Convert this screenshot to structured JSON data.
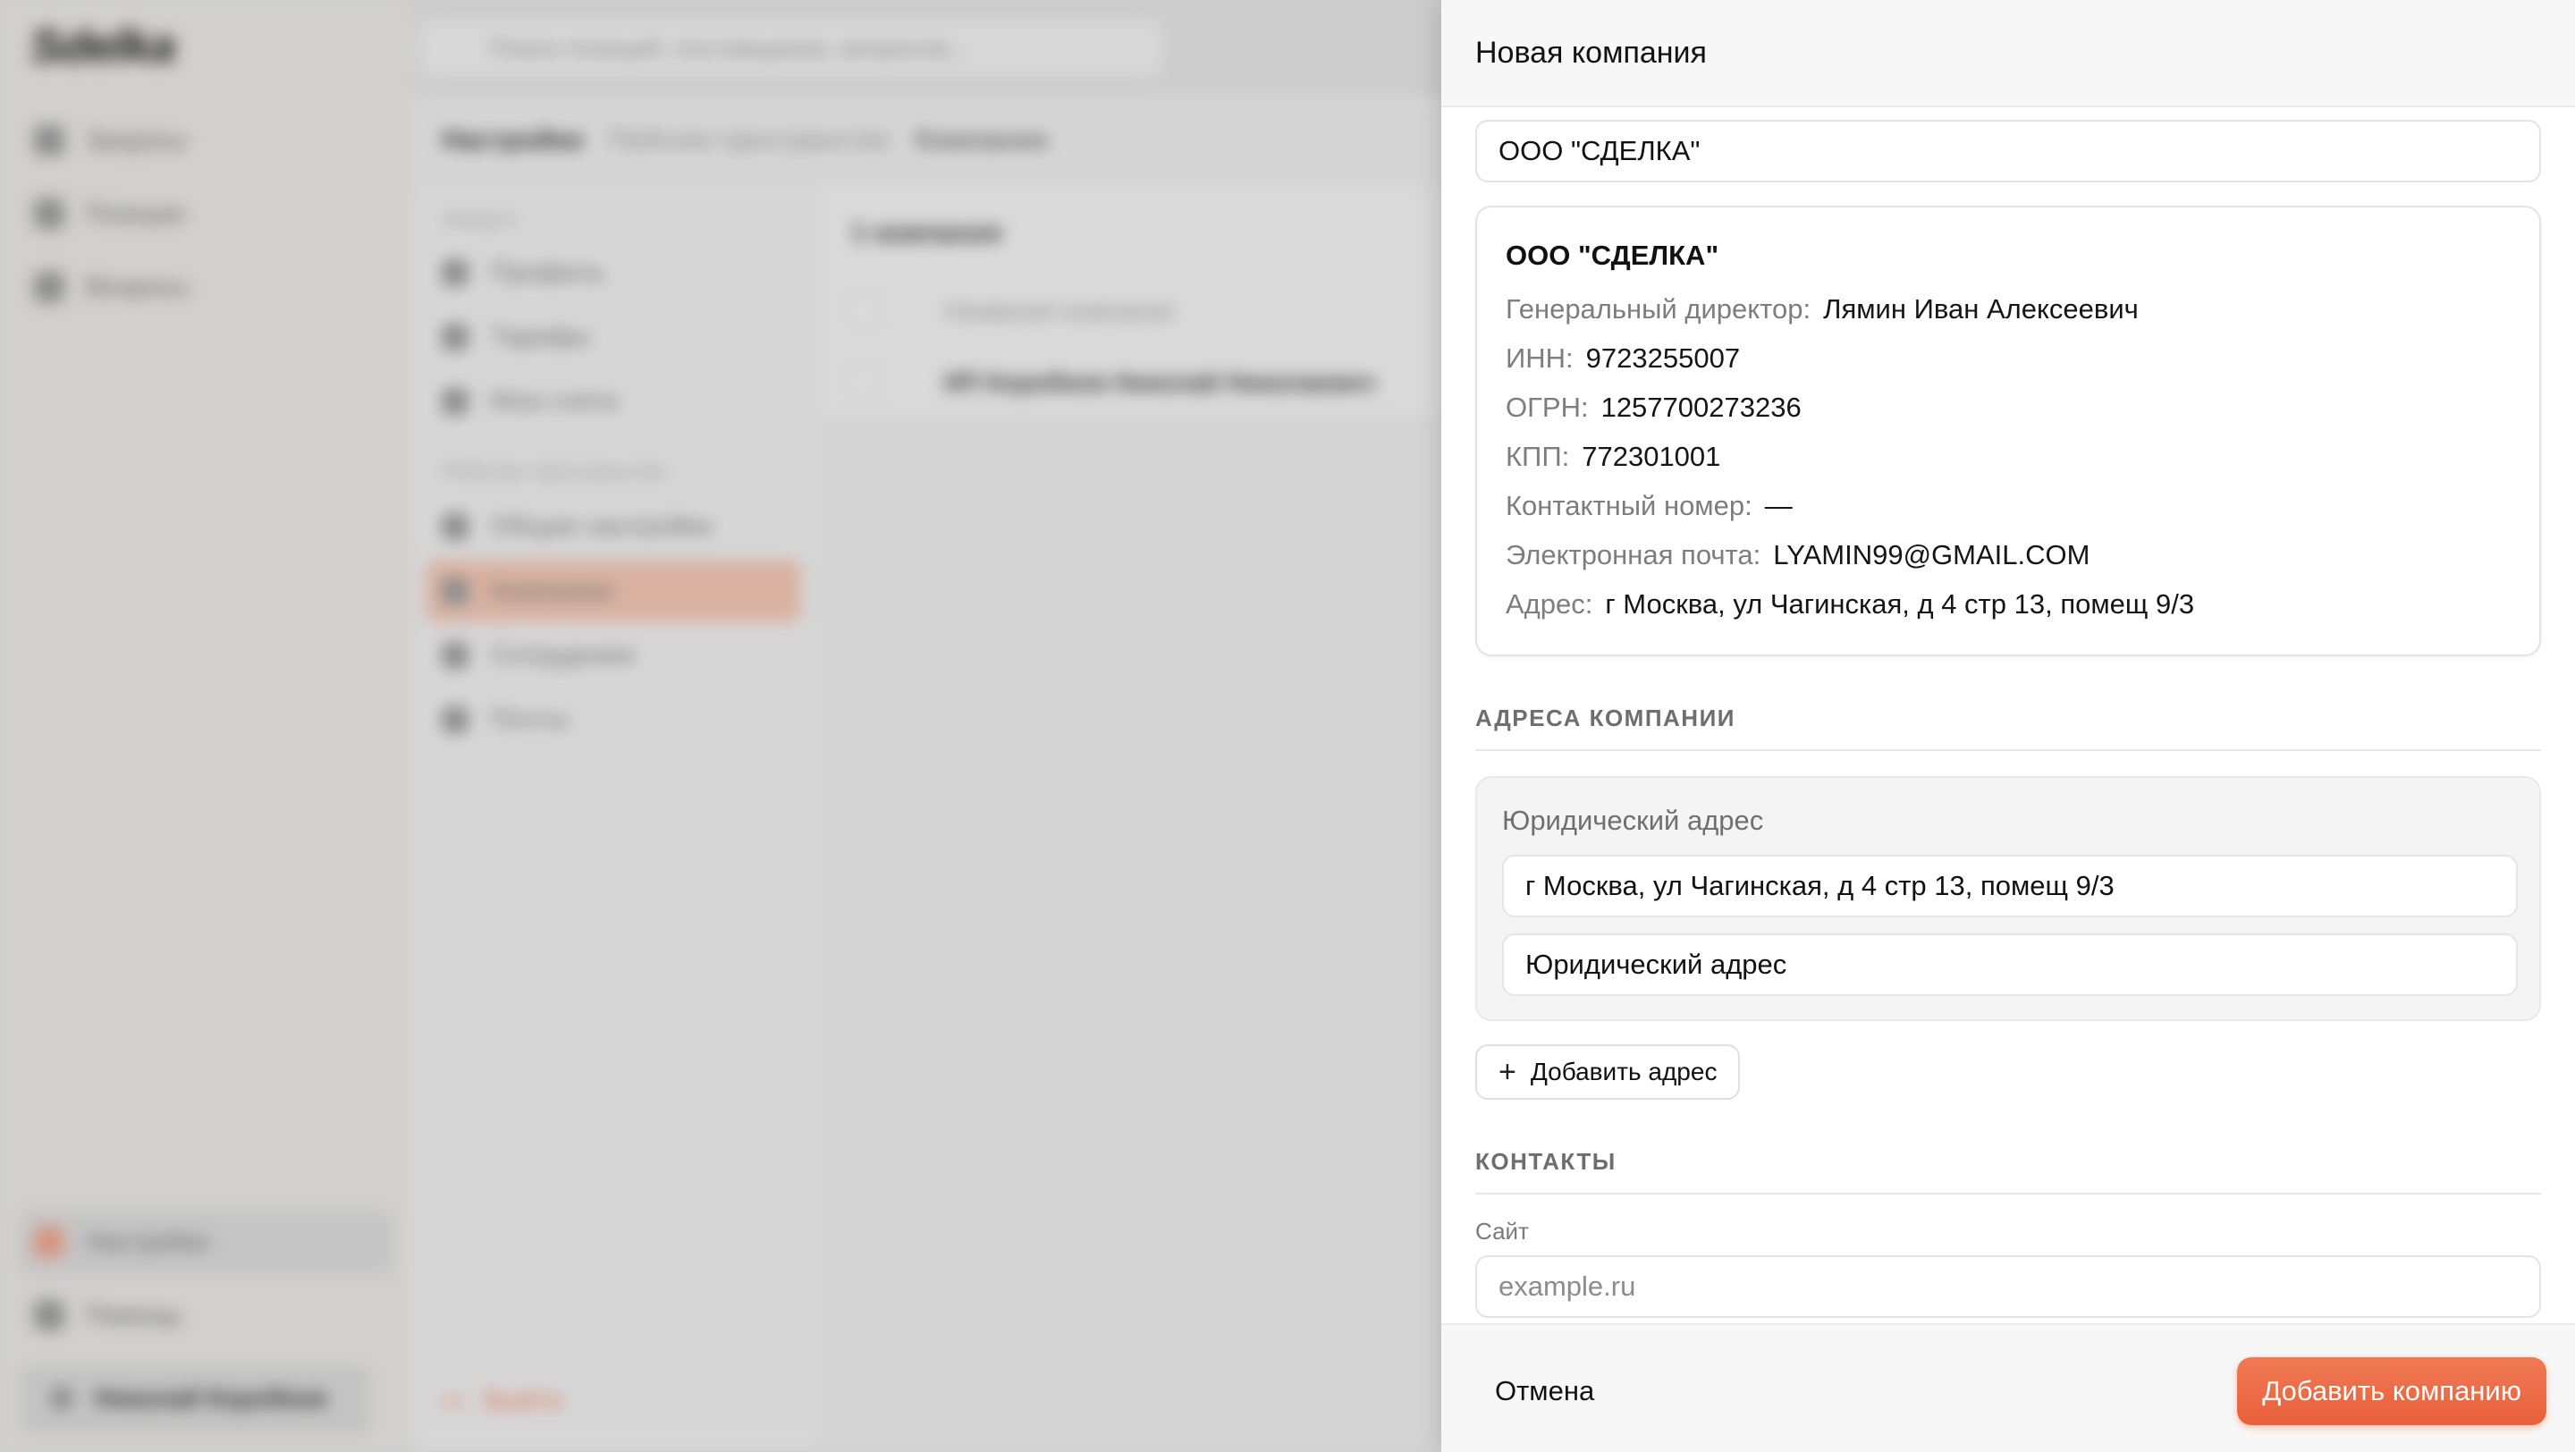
{
  "background": {
    "logo": "Sdelka",
    "search_placeholder": "Поиск позиций, поставщиков, вопросов...",
    "nav": [
      "Запросы",
      "Позиции",
      "Вопросы"
    ],
    "nav_bottom": [
      "Настройки",
      "Помощь"
    ],
    "user_name": "Николай Коробков",
    "breadcrumb": [
      "Настройки",
      "Рабочее пространство",
      "Компании"
    ],
    "subnav_account_heading": "Аккаунт",
    "subnav_account_items": [
      "Профиль",
      "Тарифы",
      "Мои счета"
    ],
    "subnav_workspace_heading": "Рабочее пространство",
    "subnav_workspace_items": [
      "Общие настройки",
      "Компании",
      "Сотрудники",
      "Почты"
    ],
    "logout": "Выйти",
    "table_count": "1 компания",
    "table_column": "Название компании",
    "table_row": "ИП Коробков Николай Николаевич"
  },
  "drawer": {
    "title": "Новая компания",
    "company_input_value": "ООО \"СДЕЛКА\"",
    "card": {
      "name": "ООО \"СДЕЛКА\"",
      "rows": [
        {
          "label": "Генеральный директор:",
          "value": "Лямин Иван Алексеевич"
        },
        {
          "label": "ИНН:",
          "value": "9723255007"
        },
        {
          "label": "ОГРН:",
          "value": "1257700273236"
        },
        {
          "label": "КПП:",
          "value": "772301001"
        },
        {
          "label": "Контактный номер:",
          "value": "—"
        },
        {
          "label": "Электронная почта:",
          "value": "LYAMIN99@GMAIL.COM"
        },
        {
          "label": "Адрес:",
          "value": "г Москва, ул Чагинская, д 4 стр 13, помещ 9/3"
        }
      ]
    },
    "addresses_section": "АДРЕСА КОМПАНИИ",
    "address_block": {
      "legend": "Юридический адрес",
      "address_value": "г Москва, ул Чагинская, д 4 стр 13, помещ 9/3",
      "type_value": "Юридический адрес"
    },
    "add_address_button": "Добавить адрес",
    "contacts_section": "КОНТАКТЫ",
    "site_label": "Сайт",
    "site_placeholder": "example.ru",
    "cancel_button": "Отмена",
    "submit_button": "Добавить компанию"
  },
  "colors": {
    "accent": "#e8603a",
    "active_nav_bg": "#f2c7b5"
  }
}
